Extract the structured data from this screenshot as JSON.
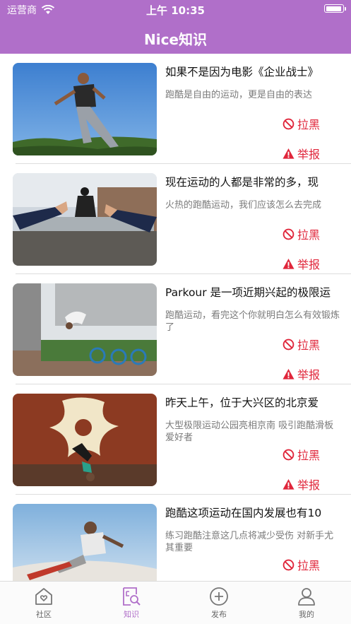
{
  "status": {
    "carrier": "运营商",
    "time": "上午 10:35",
    "battery_level": 0.95
  },
  "nav": {
    "title": "Nice知识"
  },
  "actions": {
    "block_label": "拉黑",
    "report_label": "举报"
  },
  "colors": {
    "brand": "#b06fc9",
    "danger": "#e0253a"
  },
  "articles": [
    {
      "title": "如果不是因为电影《企业战士》",
      "desc": "跑酷是自由的运动，更是自由的表达",
      "report": true
    },
    {
      "title": "现在运动的人都是非常的多，现",
      "desc": "火热的跑酷运动，我们应该怎么去完成",
      "report": true
    },
    {
      "title": "Parkour 是一项近期兴起的极限运",
      "desc": "跑酷运动，看完这个你就明白怎么有效锻炼了",
      "report": true
    },
    {
      "title": "昨天上午，位于大兴区的北京爱",
      "desc": "大型极限运动公园亮相京南 吸引跑酷滑板爱好者",
      "report": true
    },
    {
      "title": "跑酷这项运动在国内发展也有10",
      "desc": "练习跑酷注意这几点将减少受伤 对新手尤其重要",
      "report": false
    }
  ],
  "tabs": [
    {
      "label": "社区",
      "icon": "home-heart-icon",
      "active": false
    },
    {
      "label": "知识",
      "icon": "knowledge-icon",
      "active": true
    },
    {
      "label": "发布",
      "icon": "plus-circle-icon",
      "active": false
    },
    {
      "label": "我的",
      "icon": "user-icon",
      "active": false
    }
  ]
}
